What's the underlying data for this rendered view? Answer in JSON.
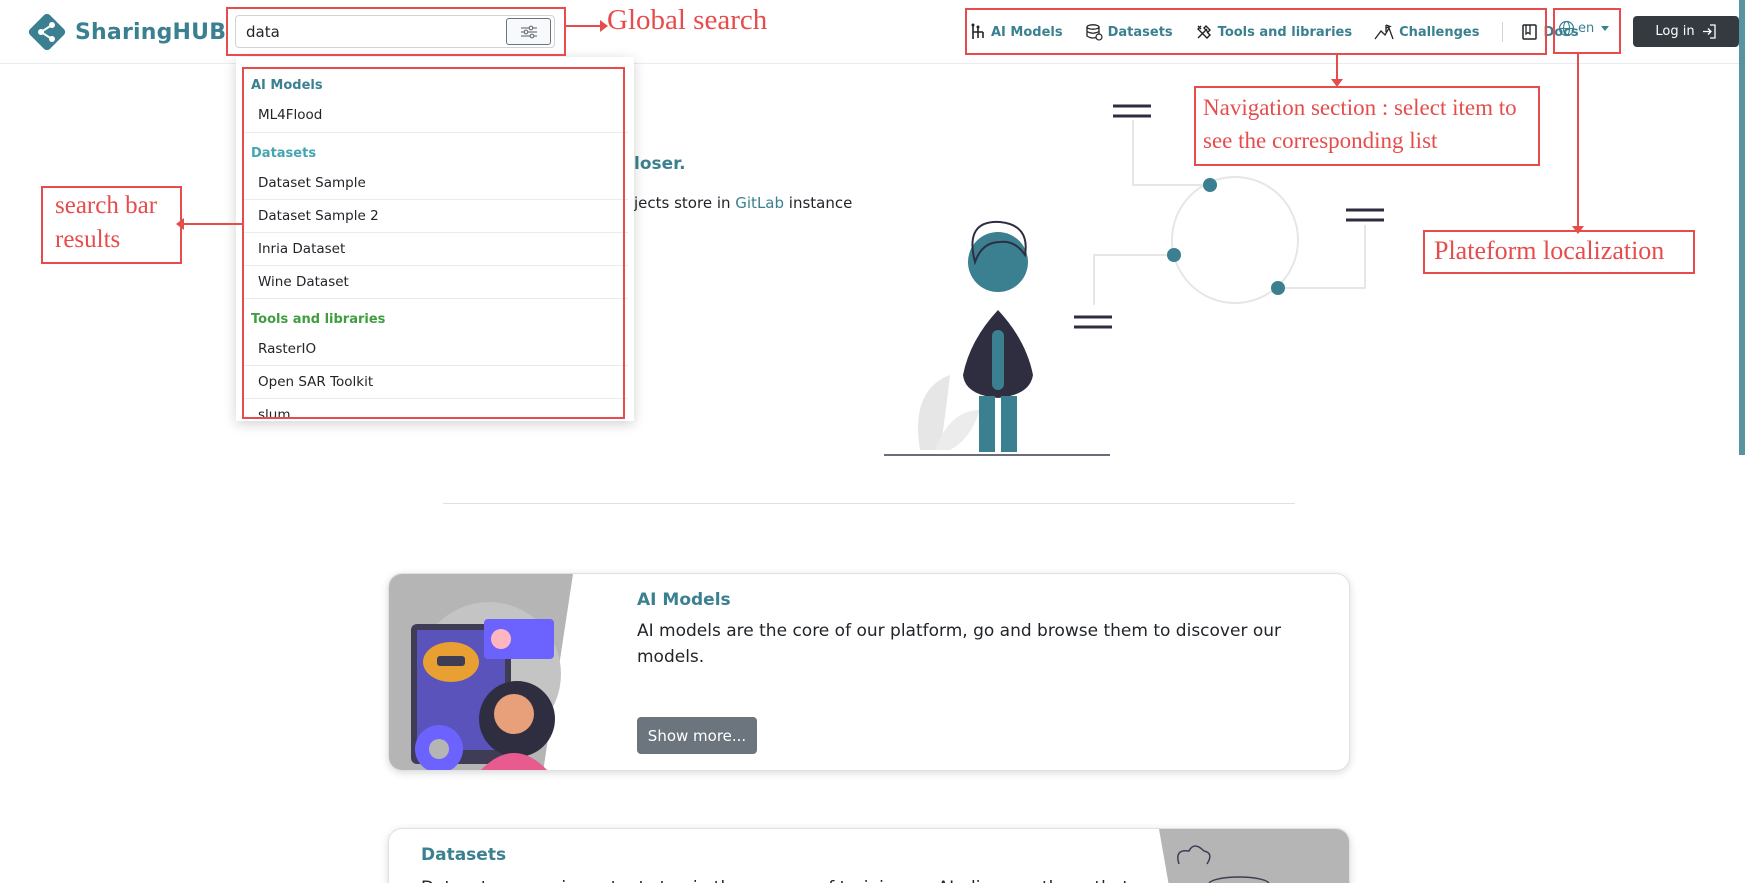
{
  "brand": {
    "name": "SharingHUB"
  },
  "search": {
    "value": "data",
    "placeholder": ""
  },
  "nav": {
    "items": [
      {
        "label": "AI Models",
        "icon": "ai-model-icon"
      },
      {
        "label": "Datasets",
        "icon": "database-icon"
      },
      {
        "label": "Tools and libraries",
        "icon": "tools-icon"
      },
      {
        "label": "Challenges",
        "icon": "challenge-icon"
      },
      {
        "label": "Docs",
        "icon": "book-icon"
      }
    ],
    "language": "en",
    "login_label": "Log in"
  },
  "hero": {
    "accent_fragment": "loser.",
    "text_before": "jects store in ",
    "link_text": "GitLab",
    "text_after": " instance"
  },
  "dropdown": {
    "groups": [
      {
        "label": "AI Models",
        "color": "#3a8090",
        "items": [
          "ML4Flood"
        ]
      },
      {
        "label": "Datasets",
        "color": "#45a5b0",
        "items": [
          "Dataset Sample",
          "Dataset Sample 2",
          "Inria Dataset",
          "Wine Dataset"
        ]
      },
      {
        "label": "Tools and libraries",
        "color": "#3f9e3f",
        "items": [
          "RasterIO",
          "Open SAR Toolkit",
          "slum"
        ]
      }
    ]
  },
  "cards": {
    "ai_models": {
      "title": "AI Models",
      "description": "AI models are the core of our platform, go and browse them to discover our models.",
      "button": "Show more..."
    },
    "datasets": {
      "title": "Datasets",
      "description_partial": "Datasets are an important step in the process of training an AI, discover those that"
    }
  },
  "annotations": {
    "global_search": "Global search",
    "search_results": [
      "search bar",
      "results"
    ],
    "navigation": [
      "Navigation section : select item to",
      "see the corresponding list"
    ],
    "localization": "Plateform localization",
    "color": "#e74c4c"
  },
  "colors": {
    "brand": "#3a8090",
    "login_bg": "#343a40",
    "button_gray": "#6c757d"
  }
}
